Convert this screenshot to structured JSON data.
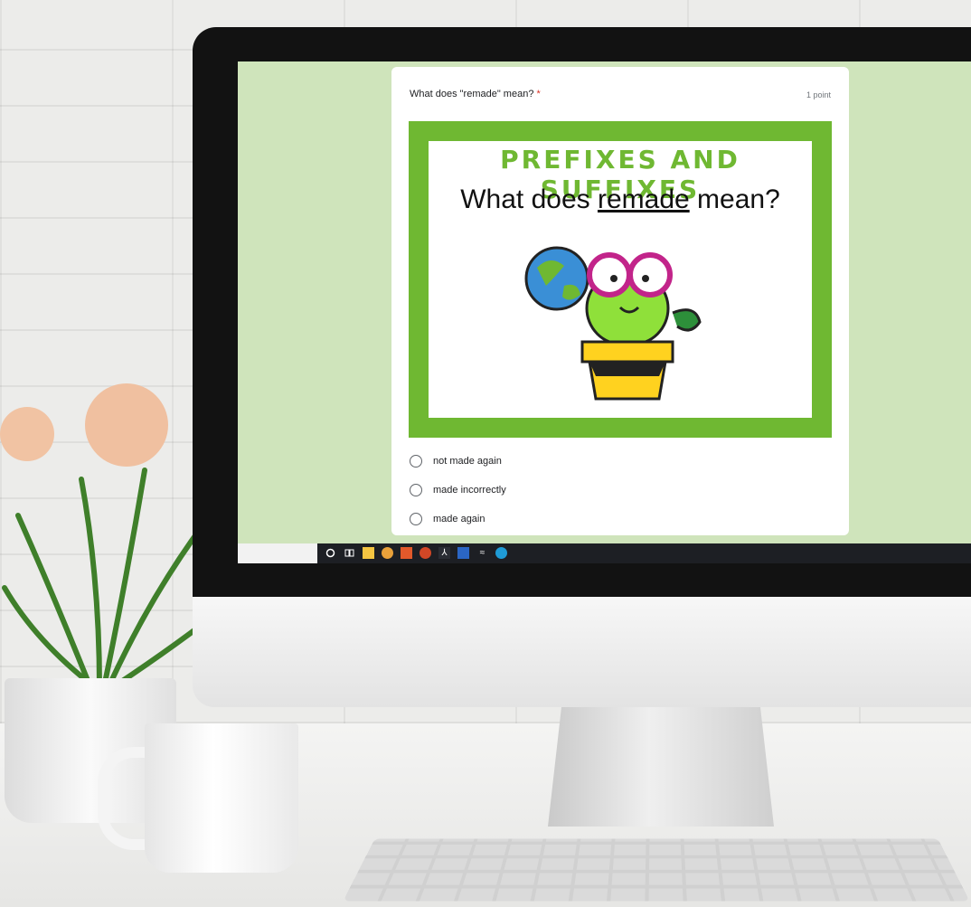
{
  "form": {
    "question": "What does \"remade\" mean?",
    "required_marker": "*",
    "points": "1 point",
    "slide": {
      "title": "PREFIXES AND SUFFIXES",
      "question_pre": "What does ",
      "question_word": "remade",
      "question_post": " mean?",
      "image": "cactus-with-globe-illustration"
    },
    "options": [
      "not made again",
      "made incorrectly",
      "made again"
    ],
    "background_color": "#cfe4bb",
    "accent_color": "#6fb832"
  },
  "taskbar": {
    "icons": [
      "search-icon",
      "task-view-icon",
      "file-explorer-icon",
      "chrome-icon",
      "office-icon",
      "powerpoint-icon",
      "acrobat-icon",
      "word-icon",
      "network-icon",
      "edge-icon"
    ]
  }
}
